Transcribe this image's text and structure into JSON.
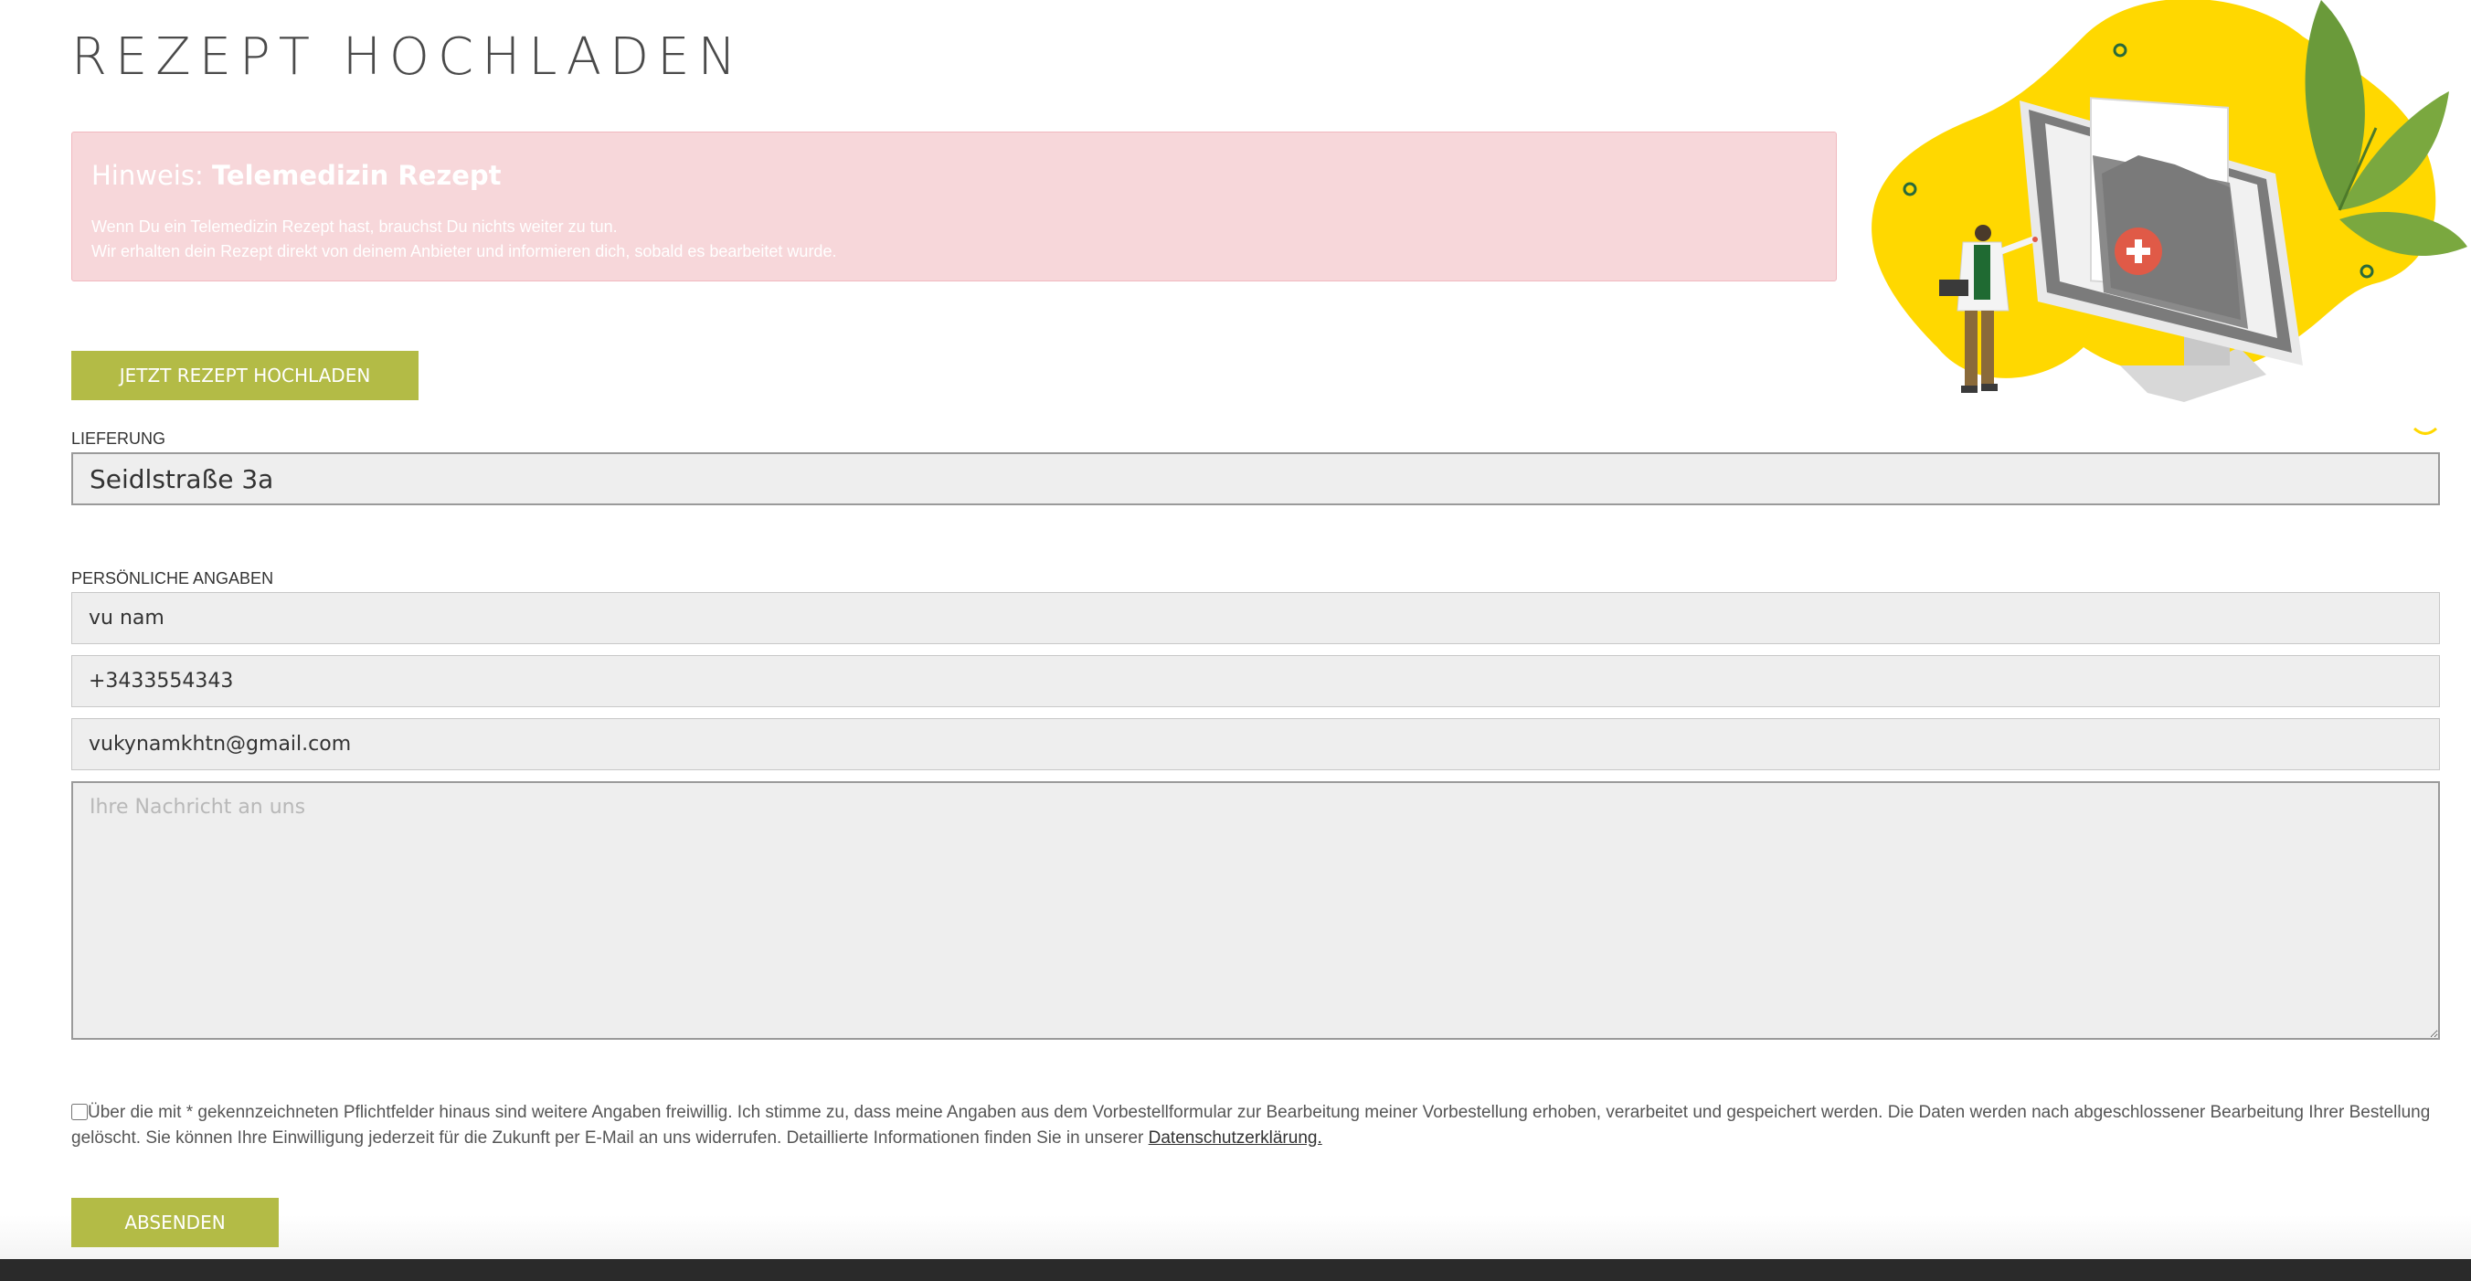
{
  "page": {
    "title": "REZEPT HOCHLADEN"
  },
  "notice": {
    "title_prefix": "Hinweis:",
    "title_bold": "Telemedizin Rezept",
    "line1": "Wenn Du ein Telemedizin Rezept hast, brauchst Du nichts weiter zu tun.",
    "line2": "Wir erhalten dein Rezept direkt von deinem Anbieter und informieren dich, sobald es bearbeitet wurde."
  },
  "upload_button": {
    "label": "JETZT REZEPT HOCHLADEN"
  },
  "delivery": {
    "label": "LIEFERUNG",
    "address_value": "Seidlstraße 3a"
  },
  "personal": {
    "label": "PERSÖNLICHE ANGABEN",
    "name_value": "vu nam",
    "phone_value": "+3433554343",
    "email_value": "vukynamkhtn@gmail.com",
    "message_placeholder": "Ihre Nachricht an uns"
  },
  "consent": {
    "text": "Über die mit * gekennzeichneten Pflichtfelder hinaus sind weitere Angaben freiwillig. Ich stimme zu, dass meine Angaben aus dem Vorbestellformular zur Bearbeitung meiner Vorbestellung erhoben, verarbeitet und gespeichert werden. Die Daten werden nach abgeschlossener Bearbeitung Ihrer Bestellung gelöscht. Sie können Ihre Einwilligung jederzeit für die Zukunft per E-Mail an uns widerrufen. Detaillierte Informationen finden Sie in unserer",
    "link_text": "Datenschutzerklärung.",
    "checked": false
  },
  "submit_button": {
    "label": "ABSENDEN"
  },
  "colors": {
    "accent": "#b3bb46",
    "notice_bg": "#f7d7da",
    "field_bg": "#eeeeee",
    "illustration_yellow": "#ffd800",
    "illustration_green": "#6a9a3a"
  },
  "icons": {
    "chevron": "chevron-down-icon",
    "illustration": "doctor-monitor-prescription-illustration"
  }
}
